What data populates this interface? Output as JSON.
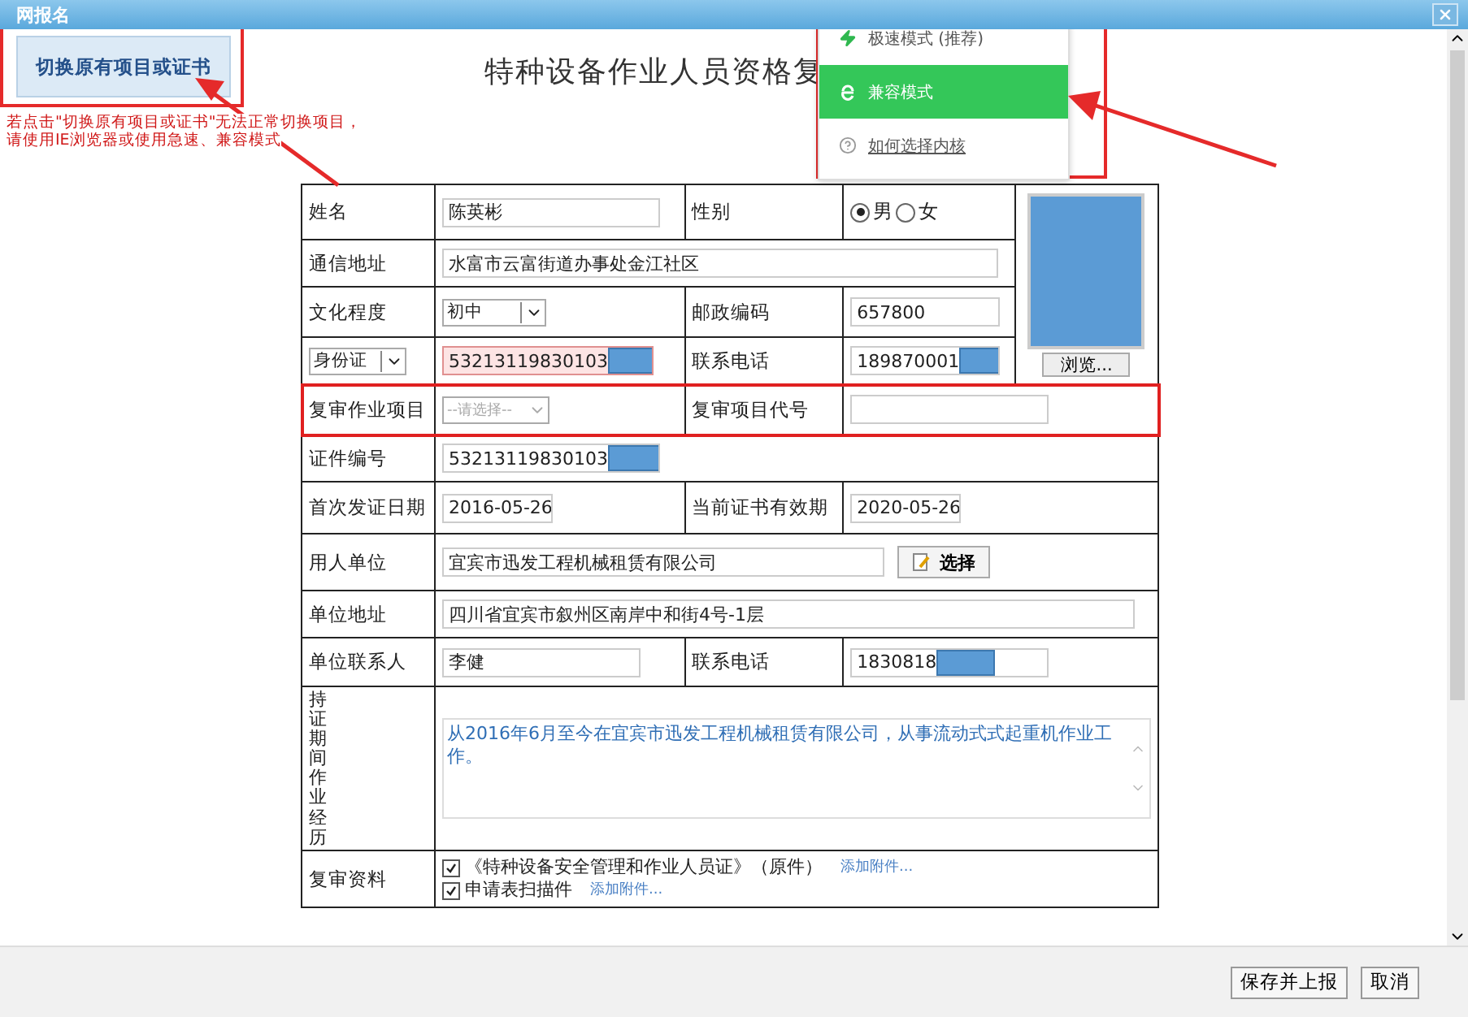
{
  "window": {
    "title": "网报名"
  },
  "switch_button": {
    "label": "切换原有项目或证书"
  },
  "notice": [
    "若点击\"切换原有项目或证书\"无法正常切换项目，",
    "请使用IE浏览器或使用急速、兼容模式"
  ],
  "heading": "特种设备作业人员资格复",
  "mode_menu": [
    {
      "kind": "bolt",
      "label": "极速模式 (推荐)",
      "selected": false
    },
    {
      "kind": "ie",
      "label": "兼容模式",
      "selected": true
    },
    {
      "kind": "help",
      "label": "如何选择内核",
      "selected": false
    }
  ],
  "form": {
    "name": {
      "label": "姓名",
      "value": "陈英彬"
    },
    "gender": {
      "label": "性别",
      "options": [
        {
          "label": "男",
          "selected": true
        },
        {
          "label": "女",
          "selected": false
        }
      ]
    },
    "photo": {
      "button": "浏览..."
    },
    "address": {
      "label": "通信地址",
      "value": "水富市云富街道办事处金江社区"
    },
    "education": {
      "label": "文化程度",
      "value": "初中"
    },
    "postal_code": {
      "label": "邮政编码",
      "value": "657800"
    },
    "id_type": {
      "value": "身份证"
    },
    "id_number": {
      "value": "53213119830103",
      "redacted": true,
      "invalid": true
    },
    "phone": {
      "label": "联系电话",
      "value": "189870001",
      "redacted": true
    },
    "review_item": {
      "label": "复审作业项目",
      "placeholder": "--请选择--",
      "disabled": true,
      "highlighted": true
    },
    "review_code": {
      "label": "复审项目代号"
    },
    "cert_number": {
      "label": "证件编号",
      "value": "53213119830103",
      "redacted": true
    },
    "first_issue_date": {
      "label": "首次发证日期",
      "value": "2016-05-26"
    },
    "valid_until": {
      "label": "当前证书有效期",
      "value": "2020-05-26"
    },
    "employer": {
      "label": "用人单位",
      "value": "宜宾市迅发工程机械租赁有限公司",
      "button": "选择"
    },
    "employer_address": {
      "label": "单位地址",
      "value": "四川省宜宾市叙州区南岸中和街4号-1层"
    },
    "contact_person": {
      "label": "单位联系人",
      "value": "李健"
    },
    "contact_phone": {
      "label": "联系电话",
      "value": "1830818",
      "redacted": true
    },
    "experience": {
      "label": "持证期间作业经历",
      "value": "从2016年6月至今在宜宾市迅发工程机械租赁有限公司，从事流动式式起重机作业工作。"
    },
    "materials": {
      "label": "复审资料",
      "items": [
        {
          "label": "《特种设备安全管理和作业人员证》（原件）",
          "checked": true,
          "link": "添加附件..."
        },
        {
          "label": "申请表扫描件",
          "checked": true,
          "link": "添加附件..."
        }
      ]
    }
  },
  "footer": {
    "buttons": [
      "保存并上报",
      "取消"
    ]
  }
}
